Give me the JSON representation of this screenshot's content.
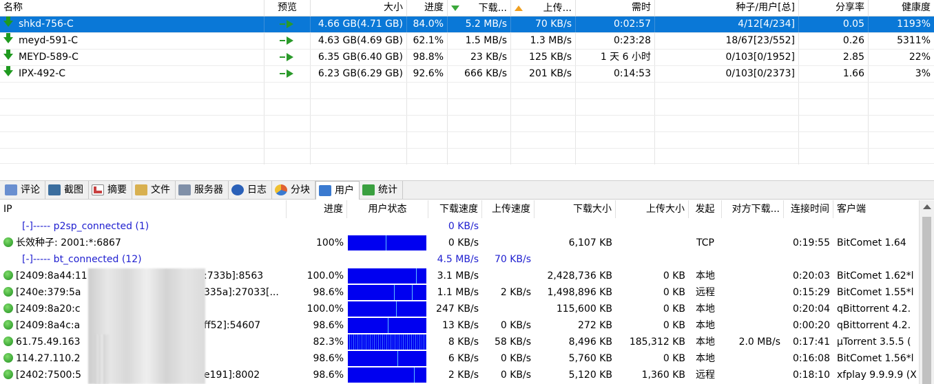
{
  "task_header": [
    "名称",
    "预览",
    "大小",
    "进度",
    "下载...",
    "上传...",
    "需时",
    "种子/用户[总]",
    "分享率",
    "健康度"
  ],
  "tasks": [
    {
      "name": "shkd-756-C",
      "size": "4.66 GB(4.71 GB)",
      "progress": "84.0%",
      "down": "5.2 MB/s",
      "up": "70 KB/s",
      "eta": "0:02:57",
      "peers": "4/12[4/234]",
      "ratio": "0.05",
      "health": "1193%",
      "selected": true
    },
    {
      "name": "meyd-591-C",
      "size": "4.63 GB(4.69 GB)",
      "progress": "62.1%",
      "down": "1.5 MB/s",
      "up": "1.3 MB/s",
      "eta": "0:23:28",
      "peers": "18/67[23/552]",
      "ratio": "0.26",
      "health": "5311%"
    },
    {
      "name": "MEYD-589-C",
      "size": "6.35 GB(6.40 GB)",
      "progress": "98.8%",
      "down": "23 KB/s",
      "up": "125 KB/s",
      "eta": "1 天 6 小时",
      "peers": "0/103[0/1952]",
      "ratio": "2.85",
      "health": "22%"
    },
    {
      "name": "IPX-492-C",
      "size": "6.23 GB(6.29 GB)",
      "progress": "92.6%",
      "down": "666 KB/s",
      "up": "201 KB/s",
      "eta": "0:14:53",
      "peers": "0/103[0/2373]",
      "ratio": "1.66",
      "health": "3%"
    }
  ],
  "tabs": [
    {
      "label": "评论",
      "icon": "comment-icon",
      "color": "#6a8fd0"
    },
    {
      "label": "截图",
      "icon": "screenshot-icon",
      "color": "#3c6e9e"
    },
    {
      "label": "摘要",
      "icon": "summary-icon",
      "color": "#c84040"
    },
    {
      "label": "文件",
      "icon": "file-icon",
      "color": "#d8b050"
    },
    {
      "label": "服务器",
      "icon": "server-icon",
      "color": "#8090a8"
    },
    {
      "label": "日志",
      "icon": "info-icon",
      "color": "#2a60b8"
    },
    {
      "label": "分块",
      "icon": "pie-icon",
      "color": "#e06030"
    },
    {
      "label": "用户",
      "icon": "users-icon",
      "color": "#3a7ad0",
      "active": true
    },
    {
      "label": "统计",
      "icon": "stats-icon",
      "color": "#3aa040"
    }
  ],
  "peer_header": [
    "IP",
    "进度",
    "用户状态",
    "下载速度",
    "上传速度",
    "下载大小",
    "上传大小",
    "发起",
    "对方下载...",
    "连接时间",
    "客户端"
  ],
  "groups": {
    "p2sp": {
      "label": "[-]----- p2sp_connected (1)",
      "down": "0 KB/s"
    },
    "bt": {
      "label": "[-]----- bt_connected (12)",
      "down": "4.5 MB/s",
      "up": "70 KB/s"
    }
  },
  "peers": [
    {
      "ip": "长效种子: 2001:*:6867",
      "progress": "100%",
      "down": "0 KB/s",
      "up": "",
      "dl_size": "6,107 KB",
      "ul_size": "",
      "origin": "TCP",
      "remote_down": "",
      "time": "0:19:55",
      "client": "BitComet 1.64"
    },
    {
      "ip": "[2409:8a44:11",
      "ip_tail": ":733b]:8563",
      "progress": "100.0%",
      "down": "3.1 MB/s",
      "up": "",
      "dl_size": "2,428,736 KB",
      "ul_size": "0 KB",
      "origin": "本地",
      "remote_down": "",
      "time": "0:20:03",
      "client": "BitComet 1.62*l"
    },
    {
      "ip": "[240e:379:5a",
      "ip_tail": "335a]:27033[...",
      "progress": "98.6%",
      "down": "1.1 MB/s",
      "up": "2 KB/s",
      "dl_size": "1,498,896 KB",
      "ul_size": "0 KB",
      "origin": "远程",
      "remote_down": "",
      "time": "0:15:29",
      "client": "BitComet 1.55*l"
    },
    {
      "ip": "[2409:8a20:c",
      "ip_tail": "",
      "progress": "100.0%",
      "down": "247 KB/s",
      "up": "",
      "dl_size": "115,600 KB",
      "ul_size": "0 KB",
      "origin": "本地",
      "remote_down": "",
      "time": "0:20:04",
      "client": "qBittorrent 4.2."
    },
    {
      "ip": "[2409:8a4c:a",
      "ip_tail": "ff52]:54607",
      "progress": "98.6%",
      "down": "13 KB/s",
      "up": "0 KB/s",
      "dl_size": "272 KB",
      "ul_size": "0 KB",
      "origin": "本地",
      "remote_down": "",
      "time": "0:00:20",
      "client": "qBittorrent 4.2."
    },
    {
      "ip": "61.75.49.163",
      "ip_tail": "",
      "progress": "82.3%",
      "down": "8 KB/s",
      "up": "58 KB/s",
      "dl_size": "8,496 KB",
      "ul_size": "185,312 KB",
      "origin": "本地",
      "remote_down": "2.0 MB/s",
      "time": "0:17:41",
      "client": "µTorrent 3.5.5 ("
    },
    {
      "ip": "114.27.110.2",
      "ip_tail": "",
      "progress": "98.6%",
      "down": "6 KB/s",
      "up": "0 KB/s",
      "dl_size": "5,760 KB",
      "ul_size": "0 KB",
      "origin": "本地",
      "remote_down": "",
      "time": "0:16:08",
      "client": "BitComet 1.56*l"
    },
    {
      "ip": "[2402:7500:5",
      "ip_tail": "e191]:8002",
      "progress": "98.6%",
      "down": "2 KB/s",
      "up": "0 KB/s",
      "dl_size": "5,120 KB",
      "ul_size": "1,360 KB",
      "origin": "远程",
      "remote_down": "",
      "time": "0:18:10",
      "client": "xfplay 9.9.9.9 (X"
    }
  ]
}
